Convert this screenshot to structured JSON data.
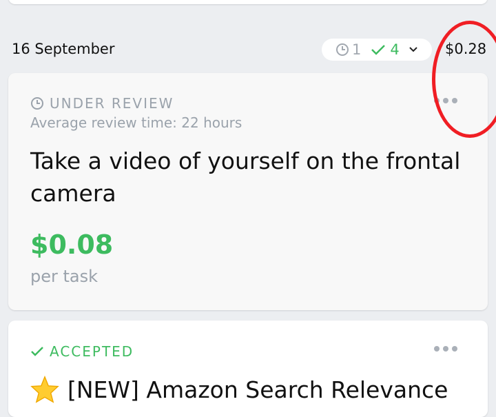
{
  "date_group": {
    "date": "16 September",
    "pending_count": "1",
    "accepted_count": "4",
    "total": "$0.28"
  },
  "tasks": [
    {
      "status": "UNDER REVIEW",
      "review_time": "Average review time: 22 hours",
      "title": "Take a video of yourself on the frontal camera",
      "price": "$0.08",
      "price_unit": "per task"
    },
    {
      "status": "ACCEPTED",
      "title": "[NEW] Amazon Search Relevance"
    }
  ],
  "icons": {
    "pending": "clock-icon",
    "accepted": "checkmark-icon",
    "expand": "chevron-down-icon",
    "menu": "more-options-icon",
    "featured": "star-icon"
  },
  "colors": {
    "accent_green": "#3dbb5f",
    "muted_gray": "#9aa2ab",
    "annotation_red": "#f01e24"
  }
}
